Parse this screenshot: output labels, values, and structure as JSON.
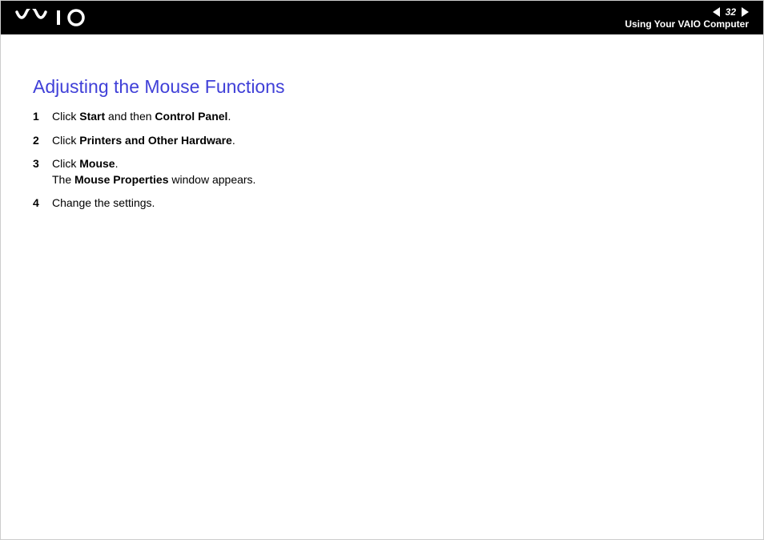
{
  "header": {
    "page_number": "32",
    "breadcrumb": "Using Your VAIO Computer"
  },
  "section": {
    "title": "Adjusting the Mouse Functions"
  },
  "steps": [
    {
      "num": "1",
      "html": "Click <b>Start</b> and then <b>Control Panel</b>."
    },
    {
      "num": "2",
      "html": "Click <b>Printers and Other Hardware</b>."
    },
    {
      "num": "3",
      "html": "Click <b>Mouse</b>.<br>The <b>Mouse Properties</b> window appears."
    },
    {
      "num": "4",
      "html": "Change the settings."
    }
  ]
}
